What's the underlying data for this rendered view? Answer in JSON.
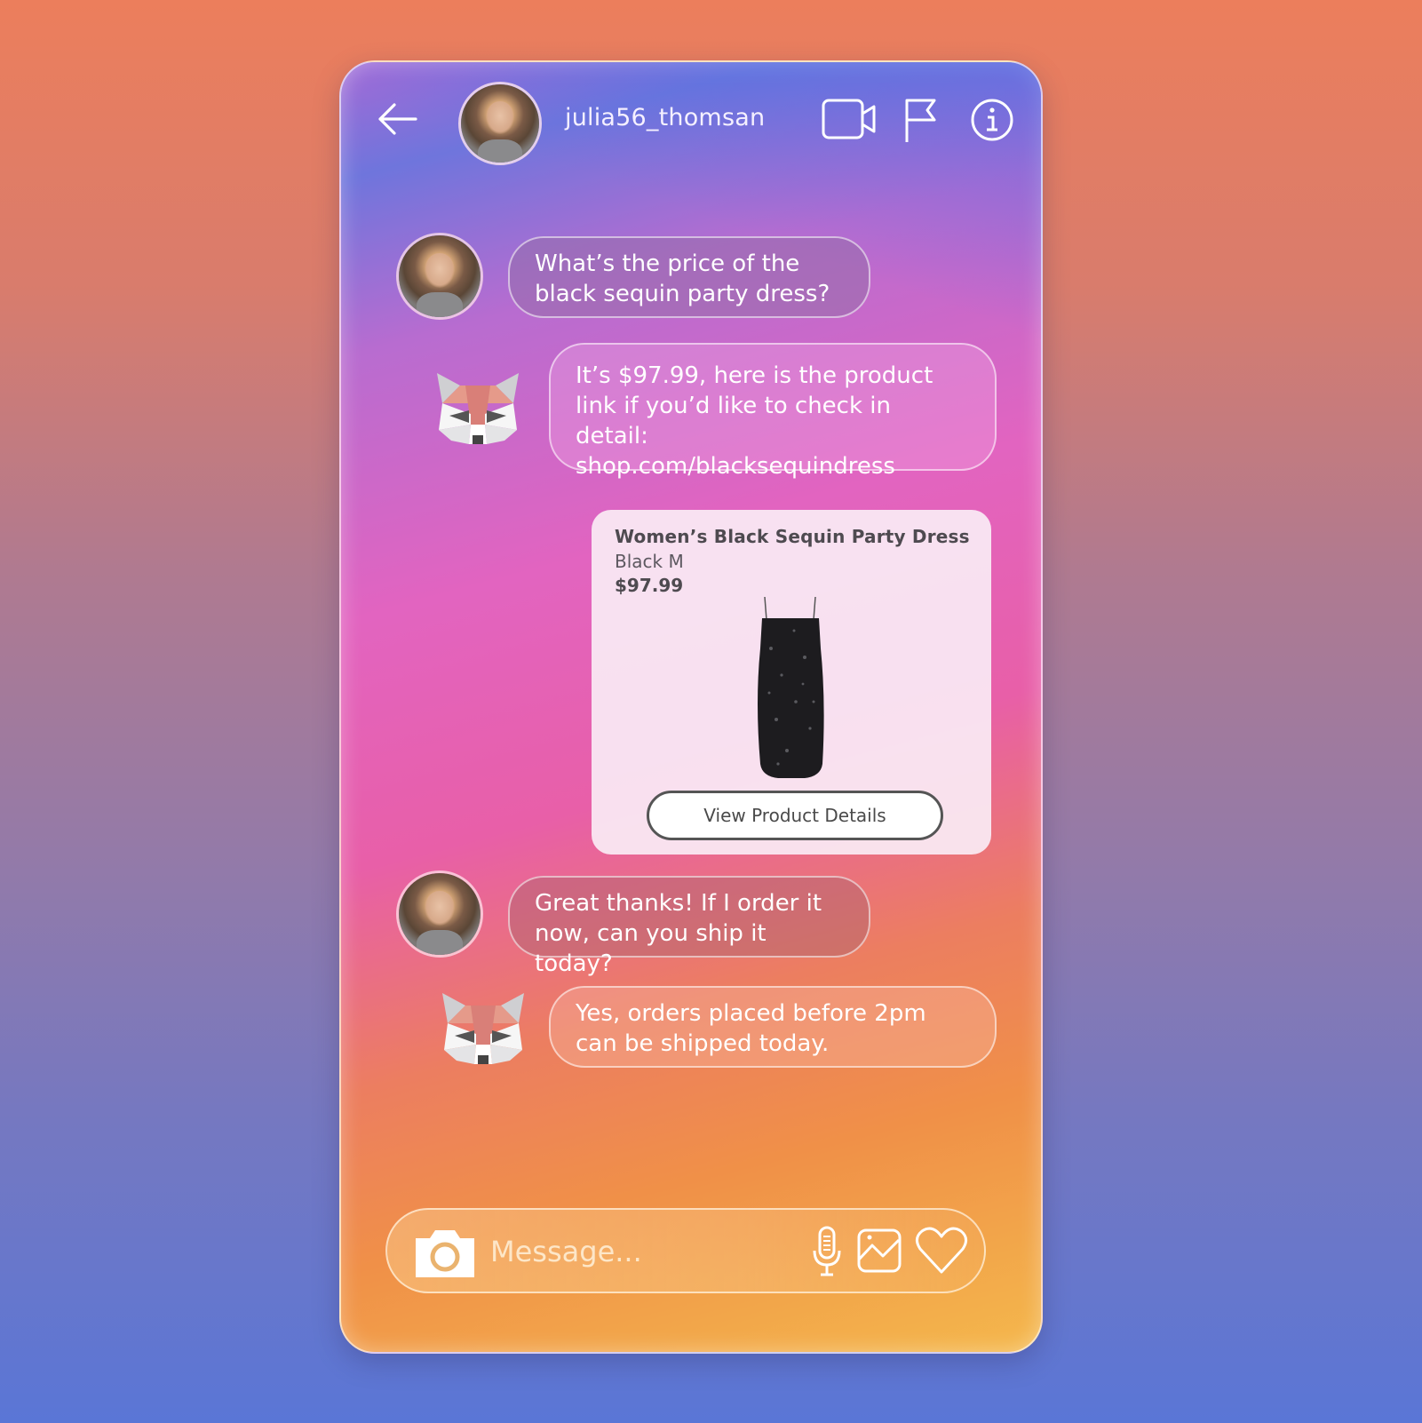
{
  "header": {
    "username": "julia56_thomsan",
    "icons": [
      "arrow-left-icon",
      "video-camera-icon",
      "flag-icon",
      "info-icon"
    ]
  },
  "messages": [
    {
      "sender": "user",
      "avatar": "user-avatar",
      "text": "What’s the price of the\nblack sequin party dress?"
    },
    {
      "sender": "bot",
      "avatar": "raccoon-bot-avatar",
      "text": "It’s $97.99, here is the product\nlink if you’d like to check in\ndetail: shop.com/blacksequindress"
    },
    {
      "sender": "user",
      "avatar": "user-avatar",
      "text": "Great thanks! If I order it\nnow, can you ship it today?"
    },
    {
      "sender": "bot",
      "avatar": "raccoon-bot-avatar",
      "text": "Yes, orders placed before 2pm\ncan be shipped today."
    }
  ],
  "product_card": {
    "title": "Women’s Black Sequin Party Dress",
    "variant": "Black M",
    "price": "$97.99",
    "button_label": "View Product Details"
  },
  "composer": {
    "placeholder": "Message...",
    "value": "",
    "icons": [
      "camera-icon",
      "microphone-icon",
      "image-icon",
      "heart-icon"
    ]
  },
  "colors": {
    "bg_top": "#ec7e5c",
    "bg_bottom": "#5a76d6",
    "text_light": "#ffffff",
    "card_text": "#4e4a50"
  }
}
